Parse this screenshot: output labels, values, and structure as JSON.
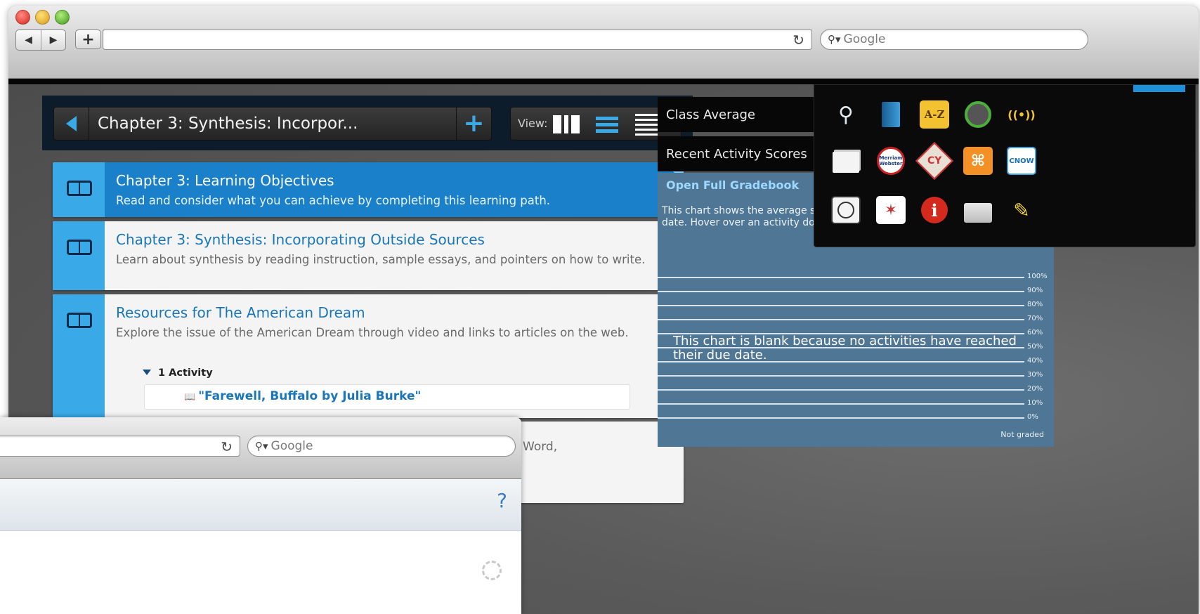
{
  "browser_back": {
    "search_placeholder": "Google"
  },
  "lp_header": {
    "chapter_title": "Chapter 3: Synthesis: Incorpor...",
    "view_label": "View:"
  },
  "items": [
    {
      "title": "Chapter 3: Learning Objectives",
      "desc": "Read and consider what you can achieve by completing this learning path."
    },
    {
      "title": "Chapter 3: Synthesis: Incorporating Outside Sources",
      "desc": "Learn about synthesis by reading instruction, sample essays, and pointers on how to write."
    },
    {
      "title": "Resources for The American Dream",
      "desc": "Explore the issue of the American Dream through video and links to articles on the web.",
      "activity_count": "1 Activity",
      "activity_link": "\"Farewell, Buffalo by Julia Burke\""
    }
  ],
  "partial_item_text": "Word,",
  "right_panel": {
    "class_average": "Class Average",
    "recent_scores": "Recent Activity Scores",
    "open_gradebook": "Open Full Gradebook",
    "chart_note": "This chart shows the average score for activities that have passed the due date. Hover over an activity dot for more information.",
    "blank_message": "This chart is blank because no activities have reached their due date.",
    "not_graded": "Not graded",
    "ticks": [
      "100%",
      "90%",
      "80%",
      "70%",
      "60%",
      "50%",
      "40%",
      "30%",
      "20%",
      "10%",
      "0%"
    ]
  },
  "tools": {
    "az_label": "A-Z",
    "mw_label": "Merriam Webster",
    "cy_label": "CY",
    "cnow_label": "CNOW",
    "info_label": "i"
  },
  "browser_front": {
    "search_placeholder": "Google",
    "help_label": "?"
  }
}
